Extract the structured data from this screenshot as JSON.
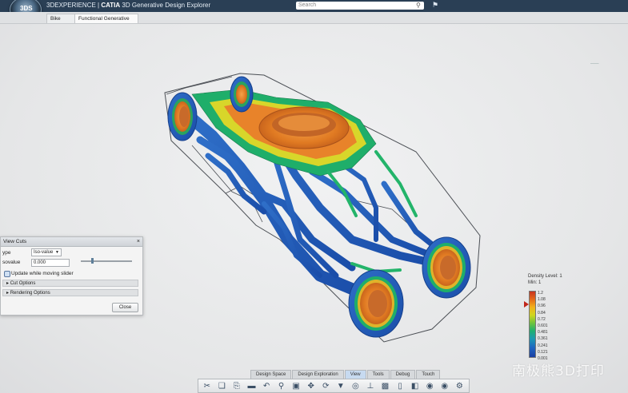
{
  "titlebar": {
    "brand_prefix": "3DEXPERIENCE | ",
    "brand_app": "CATIA",
    "brand_rest": " 3D Generative Design Explorer",
    "search_placeholder": "Search",
    "compass_mark": "3DS"
  },
  "tabs": [
    {
      "label": "Bike"
    },
    {
      "label": "Functional Generative De..."
    }
  ],
  "panel": {
    "title": "View Cuts",
    "type_label": "ype",
    "type_value": "Iso-value",
    "isovalue_label": "sovalue",
    "isovalue_value": "0.000",
    "update_label": "Update while moving slider",
    "section1": "Cut Options",
    "section2": "Rendering Options",
    "close_label": "Close"
  },
  "legend": {
    "title": "Density Level: 1",
    "subtitle": "Min: 1",
    "values": [
      "1.2",
      "1.08",
      "0.96",
      "0.84",
      "0.72",
      "0.601",
      "0.481",
      "0.361",
      "0.241",
      "0.121",
      "0.001"
    ],
    "colors": {
      "max": "#c8331f",
      "min": "#1a3fa3"
    }
  },
  "bottom_tabs": [
    {
      "label": "Design Space"
    },
    {
      "label": "Design Exploration"
    },
    {
      "label": "View",
      "active": true
    },
    {
      "label": "Tools"
    },
    {
      "label": "Debug"
    },
    {
      "label": "Touch"
    }
  ],
  "toolbar_icons": [
    "scissors-icon",
    "copy-icon",
    "paste-icon",
    "delete-icon",
    "undo-icon",
    "zoom-icon",
    "cube-icon",
    "pan-icon",
    "rotate-icon",
    "filter-icon",
    "lookat-icon",
    "axis-icon",
    "view-cube-icon",
    "front-view-icon",
    "section-icon",
    "render-icon",
    "camera-icon",
    "settings-icon",
    "more-icon"
  ],
  "watermark": "南极熊3D打印"
}
